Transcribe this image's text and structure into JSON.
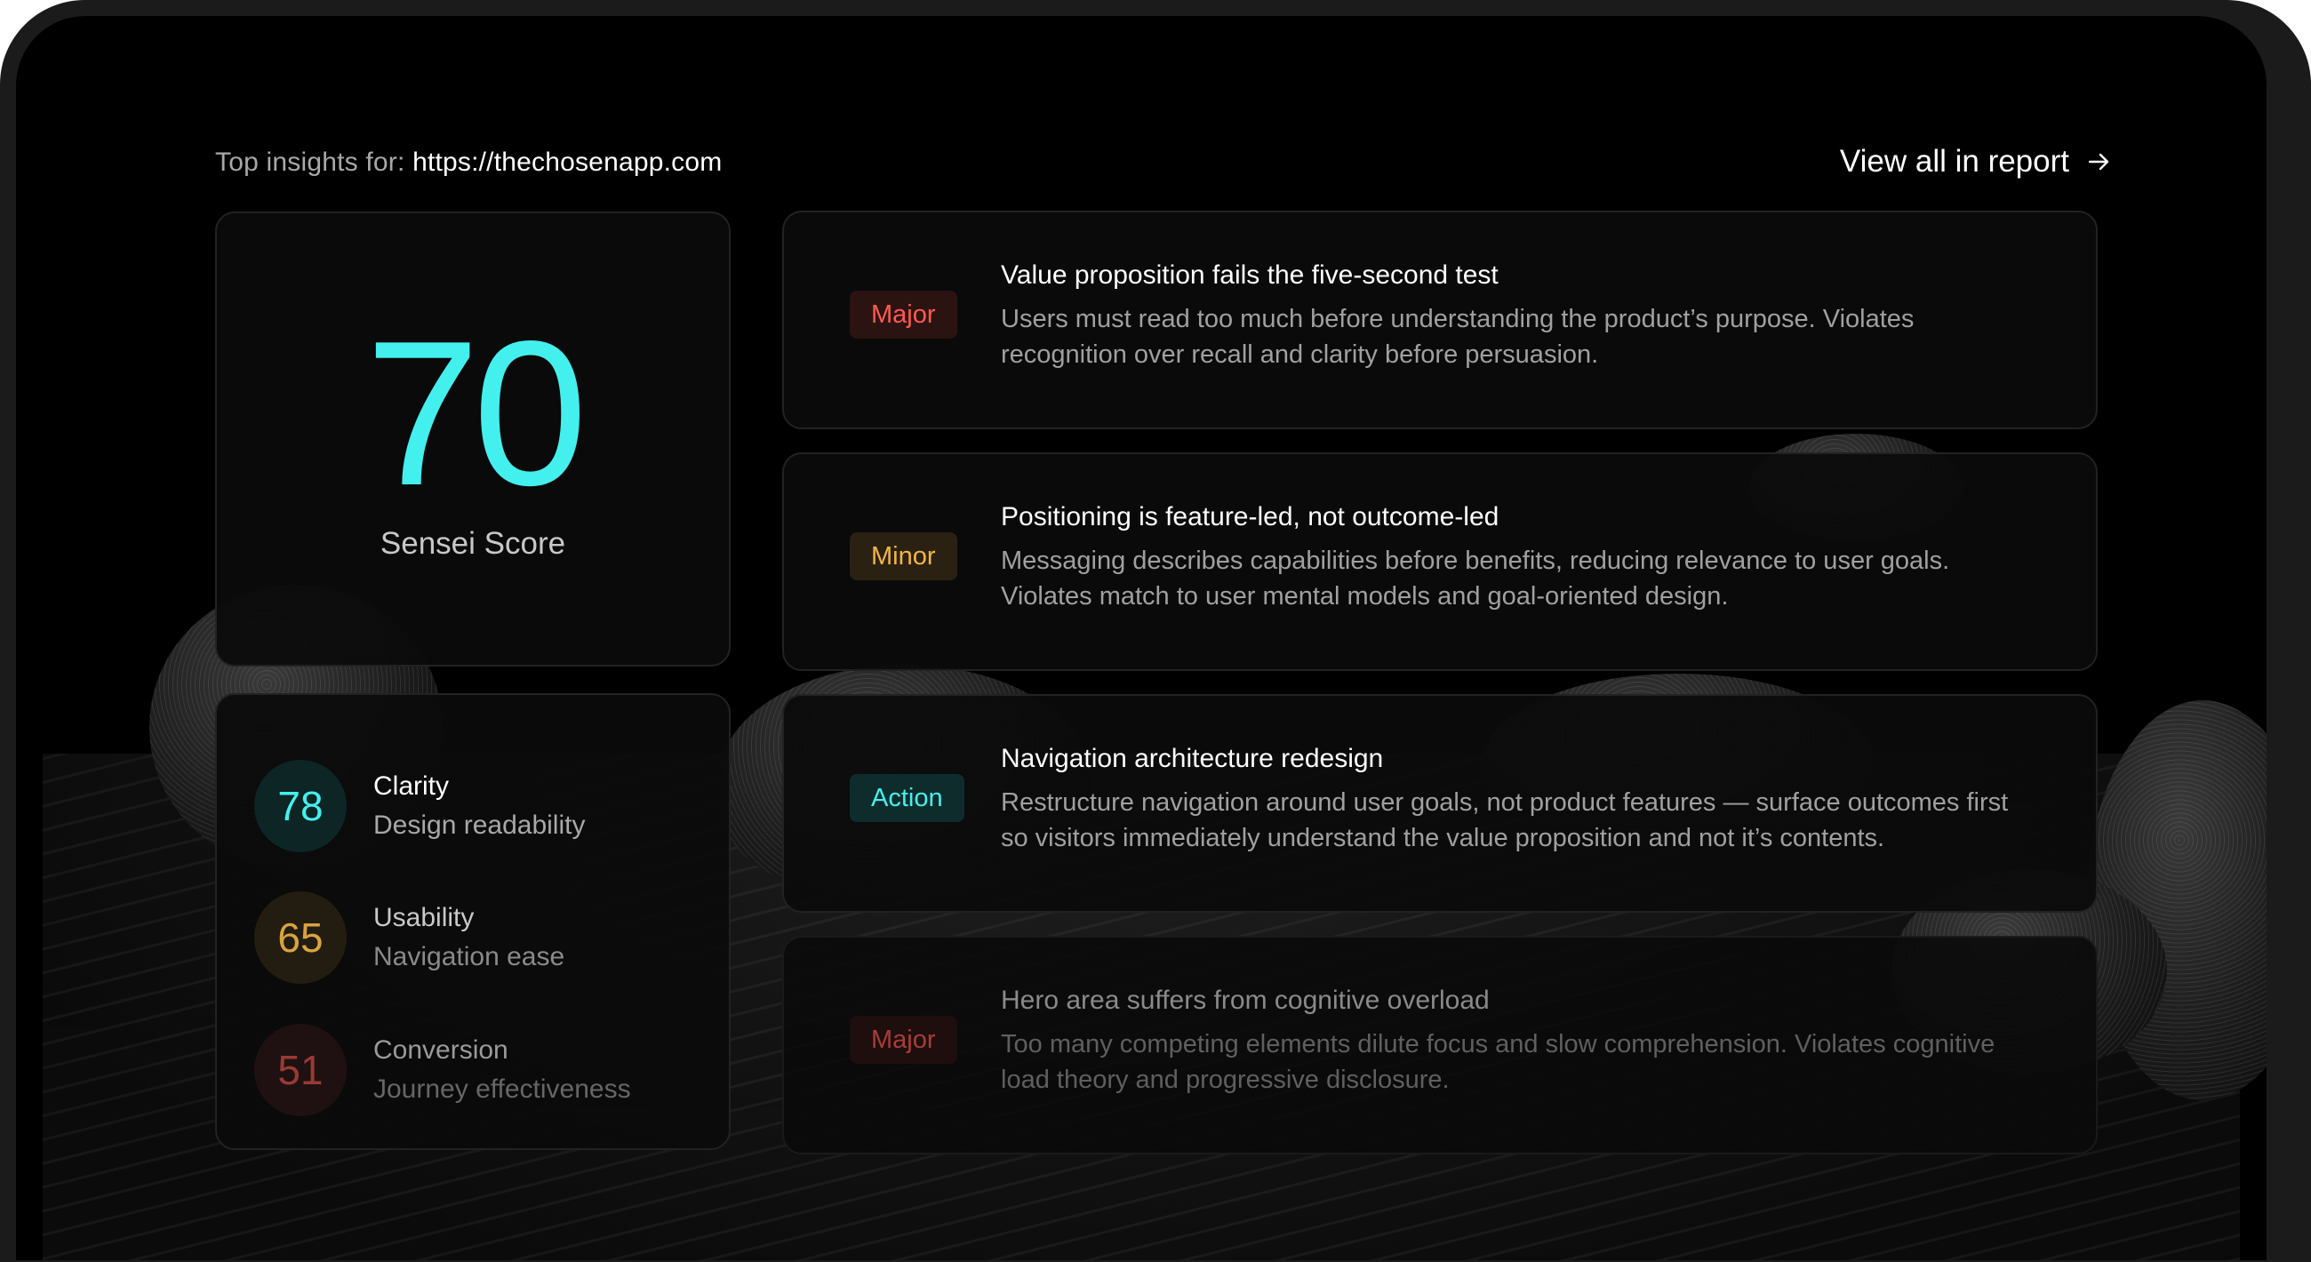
{
  "header": {
    "prefix": "Top insights for:",
    "url": "https://thechosenapp.com",
    "view_all_label": "View all in report"
  },
  "score": {
    "value": "70",
    "label": "Sensei Score",
    "color": "#43f0ee"
  },
  "metrics": [
    {
      "value": "78",
      "title": "Clarity",
      "subtitle": "Design readability",
      "color": "#43f0ee"
    },
    {
      "value": "65",
      "title": "Usability",
      "subtitle": "Navigation ease",
      "color": "#e0a840"
    },
    {
      "value": "51",
      "title": "Conversion",
      "subtitle": "Journey effectiveness",
      "color": "#d04a44"
    }
  ],
  "insights": [
    {
      "badge": "Major",
      "badge_color": "#ff5a52",
      "title": "Value proposition fails the five-second test",
      "description": "Users must read too much before understanding the product’s purpose. Violates recognition over recall and clarity before persuasion."
    },
    {
      "badge": "Minor",
      "badge_color": "#f2b544",
      "title": "Positioning is feature-led, not outcome-led",
      "description": "Messaging describes capabilities before benefits, reducing relevance to user goals. Violates match to user mental models and goal-oriented design."
    },
    {
      "badge": "Action",
      "badge_color": "#43f0ee",
      "title": "Navigation architecture redesign",
      "description": "Restructure navigation around user goals, not product features — surface outcomes first so visitors immediately understand the value proposition and not it’s contents."
    },
    {
      "badge": "Major",
      "badge_color": "#a83c36",
      "title": "Hero area suffers from cognitive overload",
      "description": "Too many competing elements dilute focus and slow comprehension. Violates cognitive load theory and progressive disclosure."
    }
  ]
}
